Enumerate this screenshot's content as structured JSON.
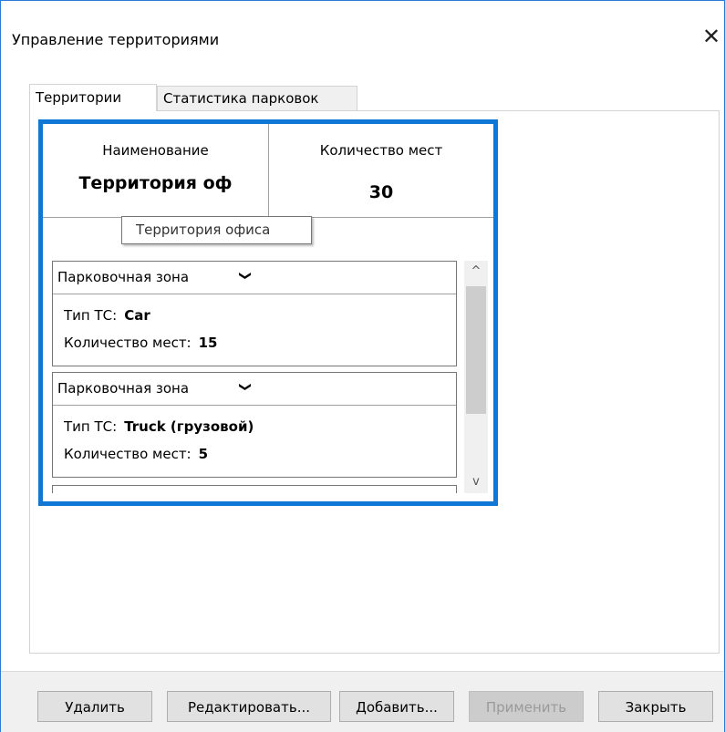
{
  "window": {
    "title": "Управление территориями",
    "close_glyph": "✕"
  },
  "tabs": [
    {
      "label": "Территории",
      "active": true
    },
    {
      "label": "Статистика парковок",
      "active": false
    }
  ],
  "territory": {
    "name_header": "Наименование",
    "name_value": "Территория оф",
    "count_header": "Количество мест",
    "count_value": "30",
    "tooltip": "Территория офиса"
  },
  "zones": [
    {
      "title": "Парковочная зона",
      "chevron": "❯",
      "type_label": "Тип ТС:",
      "type_value": "Car",
      "count_label": "Количество мест:",
      "count_value": "15"
    },
    {
      "title": "Парковочная зона",
      "chevron": "❯",
      "type_label": "Тип ТС:",
      "type_value": "Truck (грузовой)",
      "count_label": "Количество мест:",
      "count_value": "5"
    }
  ],
  "scrollbar": {
    "up_glyph": "^",
    "down_glyph": "v"
  },
  "buttons": {
    "delete": "Удалить",
    "edit": "Редактировать...",
    "add": "Добавить...",
    "apply": "Применить",
    "close": "Закрыть"
  },
  "colors": {
    "accent": "#0f78d6",
    "window_border": "#2b79d8",
    "disabled_text": "#9a9a9a"
  }
}
